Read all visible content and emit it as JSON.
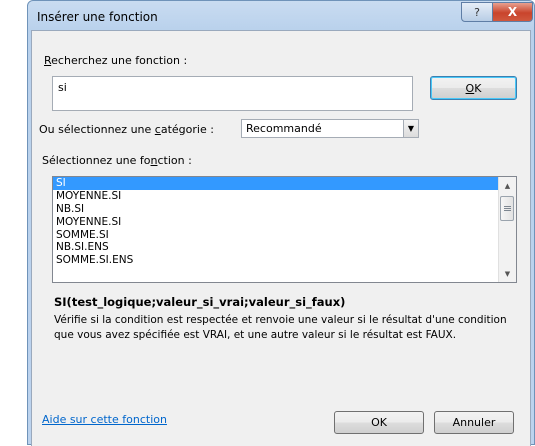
{
  "dialog": {
    "title": "Insérer une fonction",
    "help_glyph": "?",
    "close_glyph": "X"
  },
  "search": {
    "label_pre": "",
    "label_access": "R",
    "label_post": "echerchez une fonction :",
    "value": "si",
    "ok_access": "O",
    "ok_rest": "K"
  },
  "category": {
    "label_pre": "Ou sélectionnez une ",
    "label_access": "c",
    "label_post": "atégorie :",
    "selected": "Recommandé"
  },
  "function_list": {
    "label_pre": "Sélectionnez une fo",
    "label_access": "n",
    "label_post": "ction :",
    "items": [
      "SI",
      "MOYENNE.SI",
      "NB.SI",
      "MOYENNE.SI",
      "SOMME.SI",
      "NB.SI.ENS",
      "SOMME.SI.ENS"
    ],
    "selected_index": 0
  },
  "details": {
    "syntax": "SI(test_logique;valeur_si_vrai;valeur_si_faux)",
    "description": "Vérifie si la condition est respectée et renvoie une valeur si le résultat d'une condition que vous avez spécifiée est VRAI, et une autre valeur si le résultat est FAUX."
  },
  "footer": {
    "help_link": "Aide sur cette fonction",
    "ok_label": "OK",
    "cancel_label": "Annuler"
  },
  "colors": {
    "selection": "#3399ff",
    "link": "#0066cc",
    "frame": "#b9d1ec"
  }
}
